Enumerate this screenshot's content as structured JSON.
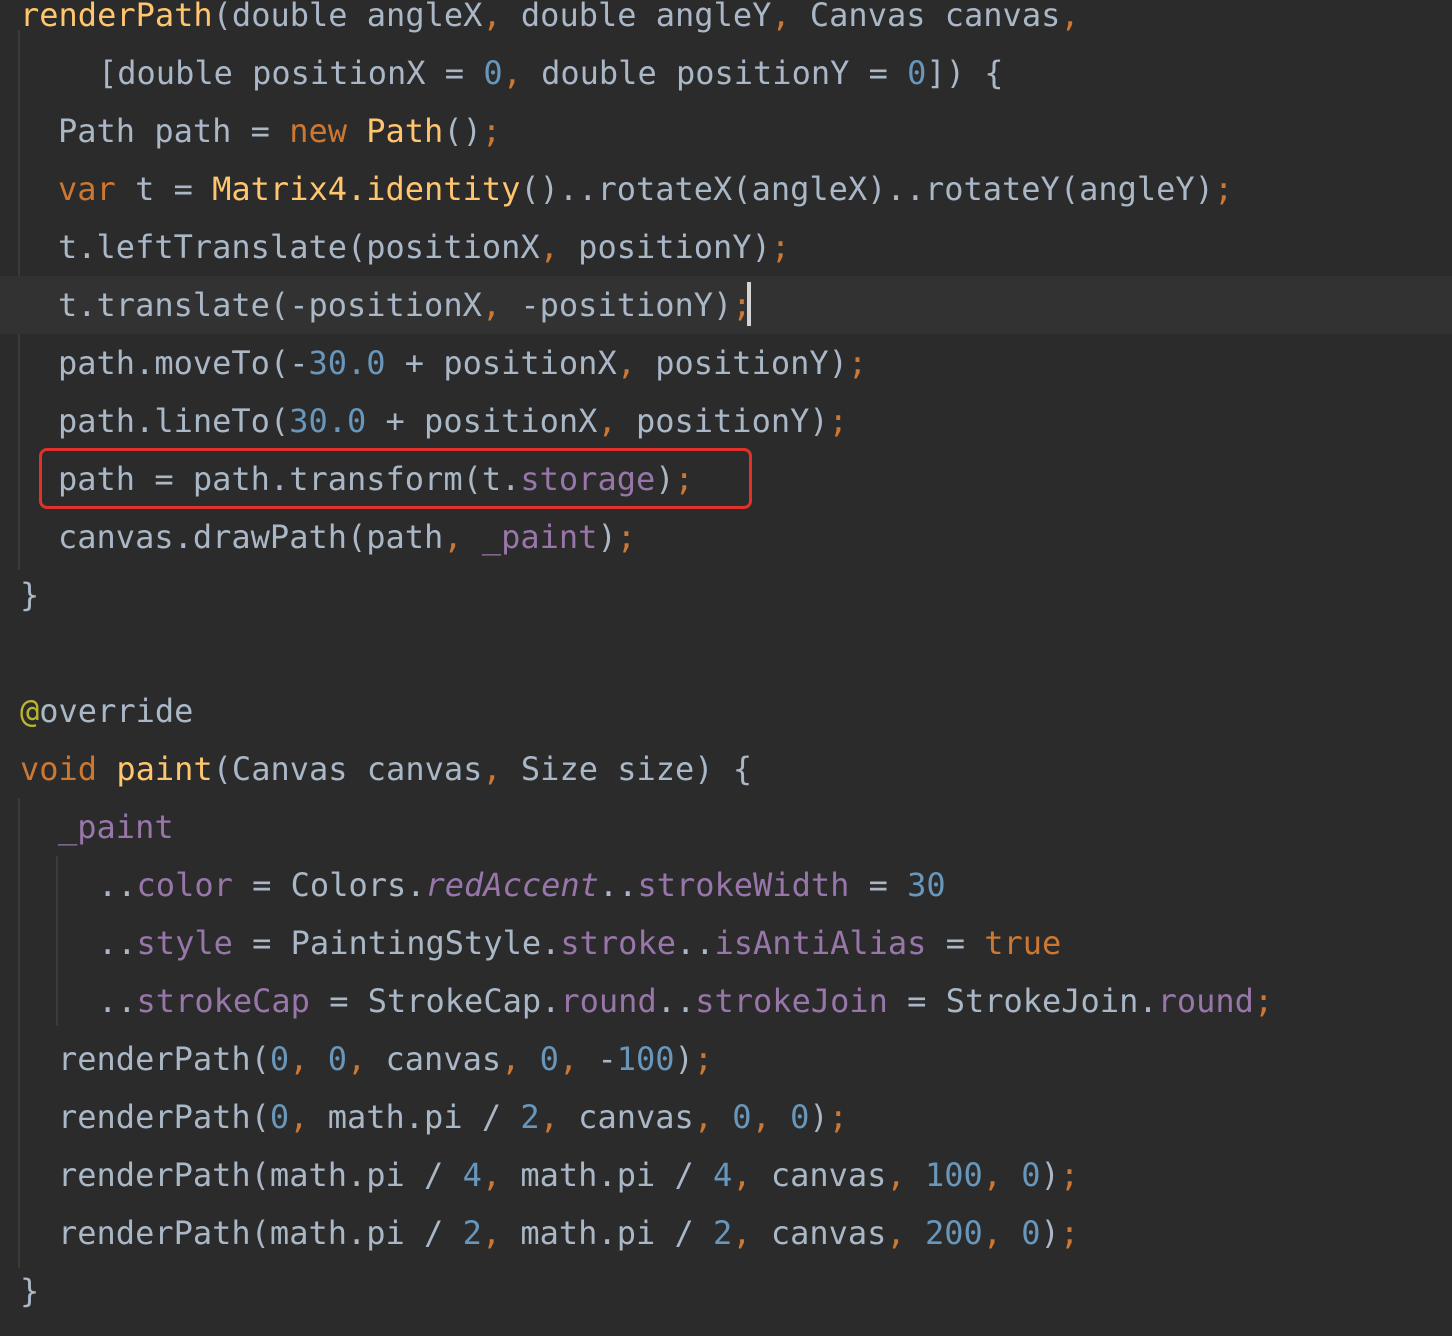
{
  "code_lines": [
    {
      "tokens": [
        {
          "t": "renderPath",
          "c": "fn"
        },
        {
          "t": "(",
          "c": "plain"
        },
        {
          "t": "double ",
          "c": "plain"
        },
        {
          "t": "angleX",
          "c": "plain"
        },
        {
          "t": ", ",
          "c": "kw"
        },
        {
          "t": "double ",
          "c": "plain"
        },
        {
          "t": "angleY",
          "c": "plain"
        },
        {
          "t": ", ",
          "c": "kw"
        },
        {
          "t": "Canvas canvas",
          "c": "plain"
        },
        {
          "t": ",",
          "c": "kw"
        }
      ]
    },
    {
      "tokens": [
        {
          "t": "[double positionX = ",
          "c": "plain"
        },
        {
          "t": "0",
          "c": "num"
        },
        {
          "t": ", ",
          "c": "kw"
        },
        {
          "t": "double positionY = ",
          "c": "plain"
        },
        {
          "t": "0",
          "c": "num"
        },
        {
          "t": "]) {",
          "c": "plain"
        }
      ]
    },
    {
      "tokens": [
        {
          "t": "Path path = ",
          "c": "plain"
        },
        {
          "t": "new ",
          "c": "kw"
        },
        {
          "t": "Path",
          "c": "fn"
        },
        {
          "t": "()",
          "c": "plain"
        },
        {
          "t": ";",
          "c": "kw"
        }
      ]
    },
    {
      "tokens": [
        {
          "t": "var ",
          "c": "kw"
        },
        {
          "t": "t = ",
          "c": "plain"
        },
        {
          "t": "Matrix4.identity",
          "c": "fn"
        },
        {
          "t": "()..rotateX(angleX)..rotateY(angleY)",
          "c": "plain"
        },
        {
          "t": ";",
          "c": "kw"
        }
      ]
    },
    {
      "tokens": [
        {
          "t": "t.leftTranslate(positionX",
          "c": "plain"
        },
        {
          "t": ", ",
          "c": "kw"
        },
        {
          "t": "positionY)",
          "c": "plain"
        },
        {
          "t": ";",
          "c": "kw"
        }
      ]
    },
    {
      "tokens": [
        {
          "t": "t.translate(-positionX",
          "c": "plain"
        },
        {
          "t": ", ",
          "c": "kw"
        },
        {
          "t": "-positionY)",
          "c": "plain"
        },
        {
          "t": ";",
          "c": "kw"
        }
      ]
    },
    {
      "tokens": [
        {
          "t": "path.moveTo(-",
          "c": "plain"
        },
        {
          "t": "30.0",
          "c": "num"
        },
        {
          "t": " + positionX",
          "c": "plain"
        },
        {
          "t": ", ",
          "c": "kw"
        },
        {
          "t": "positionY)",
          "c": "plain"
        },
        {
          "t": ";",
          "c": "kw"
        }
      ]
    },
    {
      "tokens": [
        {
          "t": "path.lineTo(",
          "c": "plain"
        },
        {
          "t": "30.0",
          "c": "num"
        },
        {
          "t": " + positionX",
          "c": "plain"
        },
        {
          "t": ", ",
          "c": "kw"
        },
        {
          "t": "positionY)",
          "c": "plain"
        },
        {
          "t": ";",
          "c": "kw"
        }
      ]
    },
    {
      "tokens": [
        {
          "t": "path = path.transform(t.",
          "c": "plain"
        },
        {
          "t": "storage",
          "c": "field"
        },
        {
          "t": ")",
          "c": "plain"
        },
        {
          "t": ";",
          "c": "kw"
        }
      ]
    },
    {
      "tokens": [
        {
          "t": "canvas.drawPath(path",
          "c": "plain"
        },
        {
          "t": ", ",
          "c": "kw"
        },
        {
          "t": "_paint",
          "c": "field"
        },
        {
          "t": ")",
          "c": "plain"
        },
        {
          "t": ";",
          "c": "kw"
        }
      ]
    },
    {
      "tokens": [
        {
          "t": "}",
          "c": "plain"
        }
      ]
    },
    {
      "tokens": []
    },
    {
      "tokens": [
        {
          "t": "@",
          "c": "ann"
        },
        {
          "t": "override",
          "c": "plain"
        }
      ]
    },
    {
      "tokens": [
        {
          "t": "void ",
          "c": "kw"
        },
        {
          "t": "paint",
          "c": "fn"
        },
        {
          "t": "(Canvas canvas",
          "c": "plain"
        },
        {
          "t": ", ",
          "c": "kw"
        },
        {
          "t": "Size size) {",
          "c": "plain"
        }
      ]
    },
    {
      "tokens": [
        {
          "t": "_paint",
          "c": "field"
        }
      ]
    },
    {
      "tokens": [
        {
          "t": "..",
          "c": "plain"
        },
        {
          "t": "color",
          "c": "field"
        },
        {
          "t": " = Colors.",
          "c": "plain"
        },
        {
          "t": "redAccent",
          "c": "field ital"
        },
        {
          "t": "..",
          "c": "plain"
        },
        {
          "t": "strokeWidth",
          "c": "field"
        },
        {
          "t": " = ",
          "c": "plain"
        },
        {
          "t": "30",
          "c": "num"
        }
      ]
    },
    {
      "tokens": [
        {
          "t": "..",
          "c": "plain"
        },
        {
          "t": "style",
          "c": "field"
        },
        {
          "t": " = PaintingStyle.",
          "c": "plain"
        },
        {
          "t": "stroke",
          "c": "field"
        },
        {
          "t": "..",
          "c": "plain"
        },
        {
          "t": "isAntiAlias",
          "c": "field"
        },
        {
          "t": " = ",
          "c": "plain"
        },
        {
          "t": "true",
          "c": "kw"
        }
      ]
    },
    {
      "tokens": [
        {
          "t": "..",
          "c": "plain"
        },
        {
          "t": "strokeCap",
          "c": "field"
        },
        {
          "t": " = StrokeCap.",
          "c": "plain"
        },
        {
          "t": "round",
          "c": "field"
        },
        {
          "t": "..",
          "c": "plain"
        },
        {
          "t": "strokeJoin",
          "c": "field"
        },
        {
          "t": " = StrokeJoin.",
          "c": "plain"
        },
        {
          "t": "round",
          "c": "field"
        },
        {
          "t": ";",
          "c": "kw"
        }
      ]
    },
    {
      "tokens": [
        {
          "t": "renderPath(",
          "c": "plain"
        },
        {
          "t": "0",
          "c": "num"
        },
        {
          "t": ", ",
          "c": "kw"
        },
        {
          "t": "0",
          "c": "num"
        },
        {
          "t": ", ",
          "c": "kw"
        },
        {
          "t": "canvas",
          "c": "plain"
        },
        {
          "t": ", ",
          "c": "kw"
        },
        {
          "t": "0",
          "c": "num"
        },
        {
          "t": ", ",
          "c": "kw"
        },
        {
          "t": "-",
          "c": "plain"
        },
        {
          "t": "100",
          "c": "num"
        },
        {
          "t": ")",
          "c": "plain"
        },
        {
          "t": ";",
          "c": "kw"
        }
      ]
    },
    {
      "tokens": [
        {
          "t": "renderPath(",
          "c": "plain"
        },
        {
          "t": "0",
          "c": "num"
        },
        {
          "t": ", ",
          "c": "kw"
        },
        {
          "t": "math.pi / ",
          "c": "plain"
        },
        {
          "t": "2",
          "c": "num"
        },
        {
          "t": ", ",
          "c": "kw"
        },
        {
          "t": "canvas",
          "c": "plain"
        },
        {
          "t": ", ",
          "c": "kw"
        },
        {
          "t": "0",
          "c": "num"
        },
        {
          "t": ", ",
          "c": "kw"
        },
        {
          "t": "0",
          "c": "num"
        },
        {
          "t": ")",
          "c": "plain"
        },
        {
          "t": ";",
          "c": "kw"
        }
      ]
    },
    {
      "tokens": [
        {
          "t": "renderPath(math.pi / ",
          "c": "plain"
        },
        {
          "t": "4",
          "c": "num"
        },
        {
          "t": ", ",
          "c": "kw"
        },
        {
          "t": "math.pi / ",
          "c": "plain"
        },
        {
          "t": "4",
          "c": "num"
        },
        {
          "t": ", ",
          "c": "kw"
        },
        {
          "t": "canvas",
          "c": "plain"
        },
        {
          "t": ", ",
          "c": "kw"
        },
        {
          "t": "100",
          "c": "num"
        },
        {
          "t": ", ",
          "c": "kw"
        },
        {
          "t": "0",
          "c": "num"
        },
        {
          "t": ")",
          "c": "plain"
        },
        {
          "t": ";",
          "c": "kw"
        }
      ]
    },
    {
      "tokens": [
        {
          "t": "renderPath(math.pi / ",
          "c": "plain"
        },
        {
          "t": "2",
          "c": "num"
        },
        {
          "t": ", ",
          "c": "kw"
        },
        {
          "t": "math.pi / ",
          "c": "plain"
        },
        {
          "t": "2",
          "c": "num"
        },
        {
          "t": ", ",
          "c": "kw"
        },
        {
          "t": "canvas",
          "c": "plain"
        },
        {
          "t": ", ",
          "c": "kw"
        },
        {
          "t": "200",
          "c": "num"
        },
        {
          "t": ", ",
          "c": "kw"
        },
        {
          "t": "0",
          "c": "num"
        },
        {
          "t": ")",
          "c": "plain"
        },
        {
          "t": ";",
          "c": "kw"
        }
      ]
    },
    {
      "tokens": [
        {
          "t": "}",
          "c": "plain"
        }
      ]
    }
  ],
  "current_line": 6,
  "highlighted_line": 9,
  "colors": {
    "background": "#2b2b2b",
    "current_line": "#323232",
    "keyword": "#cc7832",
    "function": "#ffc66d",
    "number": "#6897bb",
    "field": "#9876aa",
    "text": "#a9b7c6",
    "highlight_box": "#e0312b"
  }
}
